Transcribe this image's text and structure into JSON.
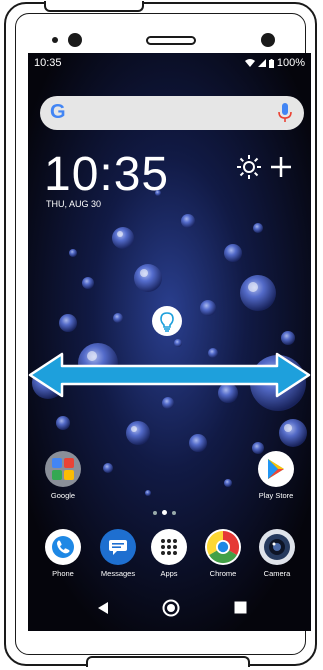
{
  "status_bar": {
    "time": "10:35",
    "battery": "100%"
  },
  "search": {
    "logo": "G",
    "icon": "mic-icon"
  },
  "clock": {
    "time": "10:35",
    "date": "THU, AUG 30"
  },
  "gesture_hint": {
    "icon": "lightbulb-icon",
    "direction": "horizontal-swipe",
    "arrow_color": "#1ea0dc"
  },
  "home_apps": {
    "google_label": "Google",
    "play_store_label": "Play Store"
  },
  "dock": [
    {
      "label": "Phone",
      "icon": "phone-icon",
      "color": "#1e88e5"
    },
    {
      "label": "Messages",
      "icon": "messages-icon",
      "color": "#1e6fd0"
    },
    {
      "label": "Apps",
      "icon": "apps-grid-icon",
      "color": "#ffffff"
    },
    {
      "label": "Chrome",
      "icon": "chrome-icon",
      "color": "#e53935"
    },
    {
      "label": "Camera",
      "icon": "camera-icon",
      "color": "#263a5e"
    }
  ],
  "page_indicator": {
    "pages": 3,
    "current": 2
  },
  "nav": {
    "back_icon": "back-triangle-icon",
    "home_icon": "home-circle-icon",
    "recents_icon": "recents-square-icon"
  }
}
